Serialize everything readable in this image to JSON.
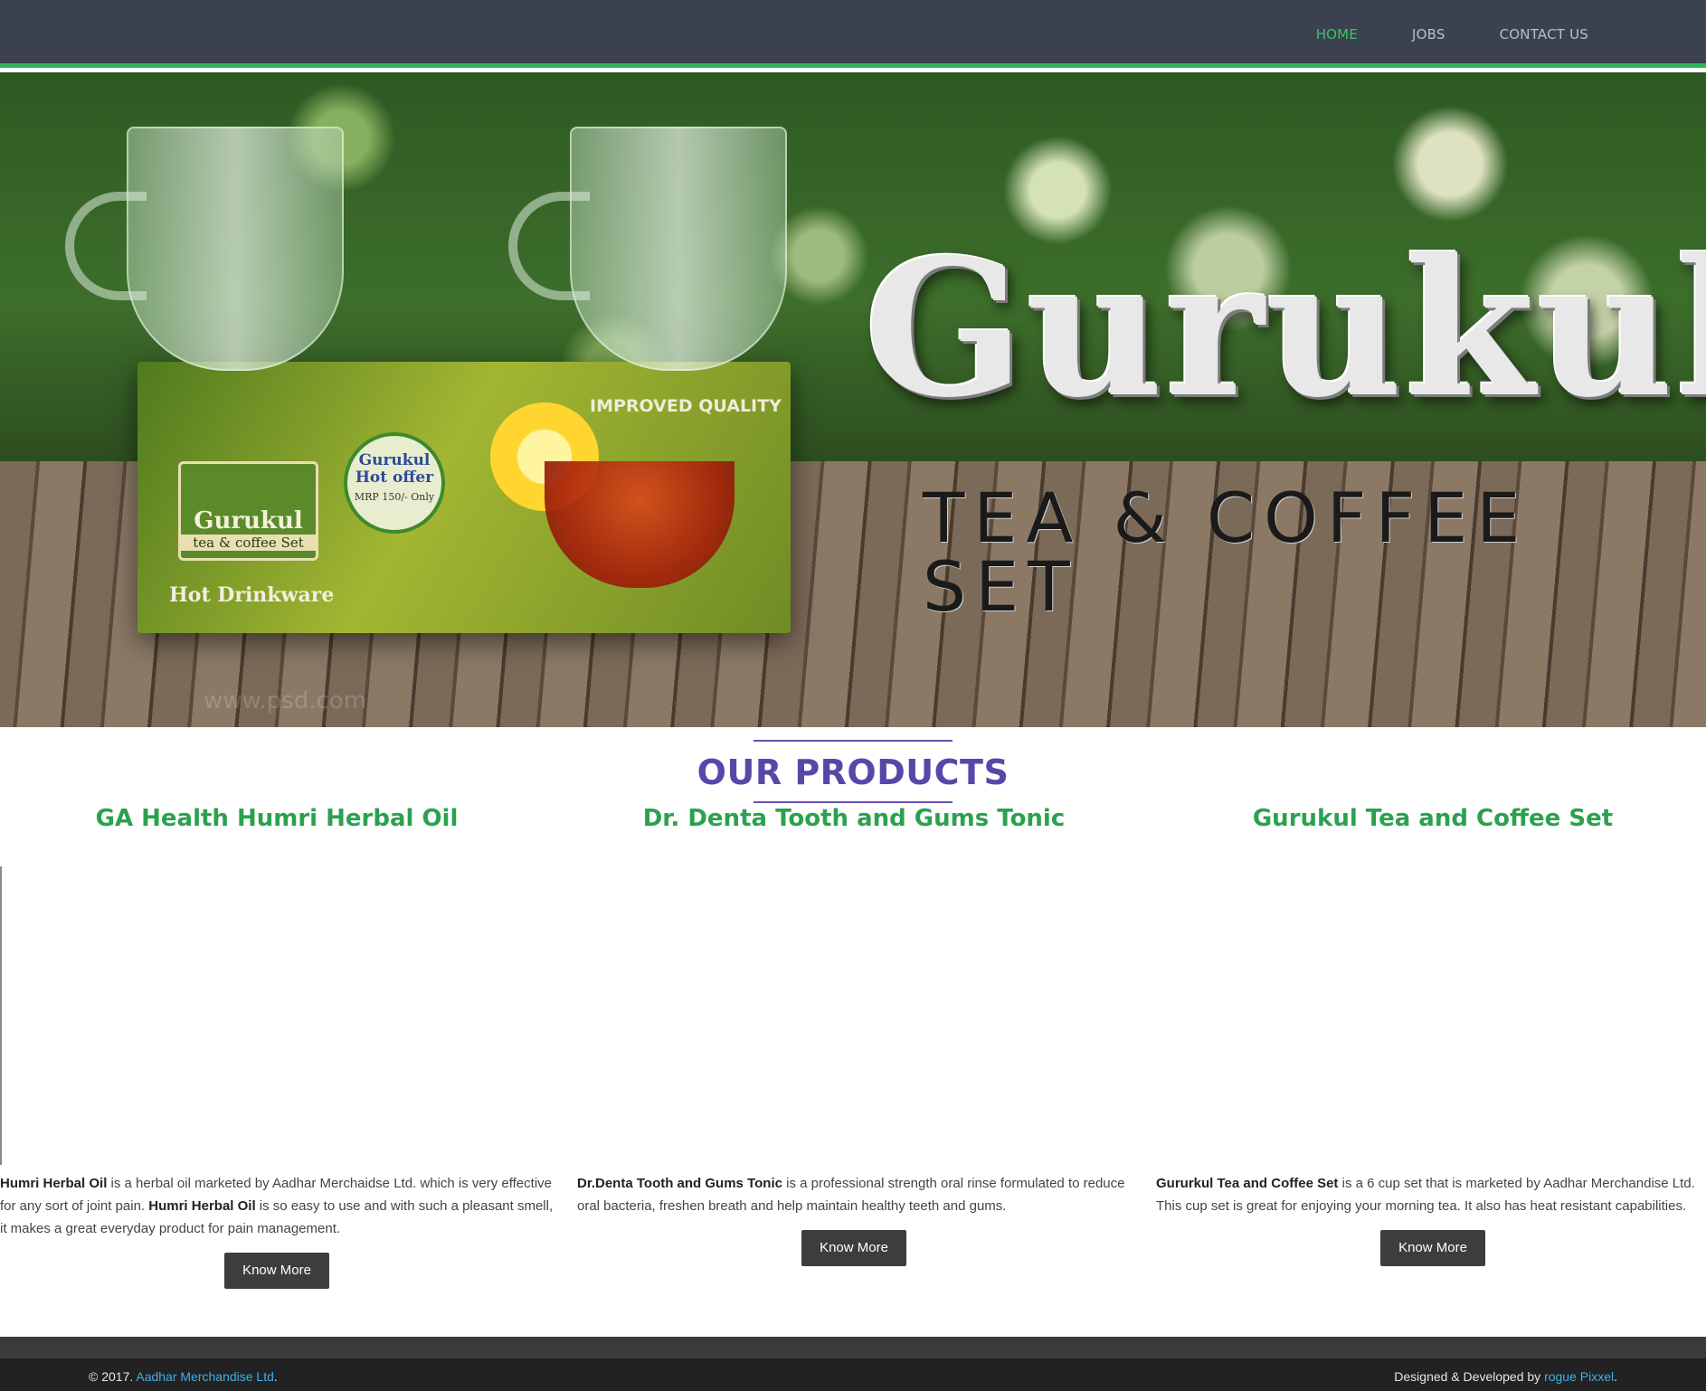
{
  "nav": {
    "items": [
      {
        "label": "HOME",
        "active": true
      },
      {
        "label": "JOBS",
        "active": false
      },
      {
        "label": "CONTACT US",
        "active": false
      }
    ]
  },
  "hero": {
    "title": "Gurukul",
    "subtitle": "TEA & COFFEE SET",
    "box_brand": "Gurukul",
    "box_brand_sub": "tea & coffee Set",
    "box_hot": "Hot Drinkware",
    "box_quality": "IMPROVED QUALITY",
    "offer_title": "Gurukul Hot offer",
    "offer_mrp": "MRP 150/- Only",
    "watermark": "www.psd.com"
  },
  "products_section": {
    "title": "OUR PRODUCTS"
  },
  "products": [
    {
      "name": "GA Health Humri Herbal Oil",
      "desc_bold1": "Humri Herbal Oil",
      "desc_text1": " is a herbal oil marketed by Aadhar Merchaidse Ltd. which is very effective for any sort of joint pain. ",
      "desc_bold2": "Humri Herbal Oil",
      "desc_text2": " is so easy to use and with such a pleasant smell, it makes a great everyday product for pain management.",
      "button": "Know More"
    },
    {
      "name": "Dr. Denta Tooth and Gums Tonic",
      "desc_bold1": "Dr.Denta Tooth and Gums Tonic",
      "desc_text1": " is a professional strength oral rinse formulated to reduce oral bacteria, freshen breath and help maintain healthy teeth and gums.",
      "button": "Know More"
    },
    {
      "name": "Gurukul Tea and Coffee Set",
      "desc_bold1": "Gururkul Tea and Coffee Set",
      "desc_text1": " is a 6 cup set that is marketed by Aadhar Merchandise Ltd. This cup set is great for enjoying your morning tea. It also has heat resistant capabilities.",
      "button": "Know More"
    }
  ],
  "footer": {
    "copy_prefix": "© 2017. ",
    "company": "Aadhar Merchandise Ltd",
    "copy_suffix": ".",
    "credit_prefix": "Designed & Developed by ",
    "developer": "rogue Pixxel",
    "credit_suffix": "."
  },
  "colors": {
    "navbar": "#3b414f",
    "accent_green": "#2fb35a",
    "section_title": "#5a46a8",
    "product_name": "#2ba14f",
    "button": "#3d3d3d",
    "footer": "#222222",
    "link": "#3fb0e8"
  }
}
